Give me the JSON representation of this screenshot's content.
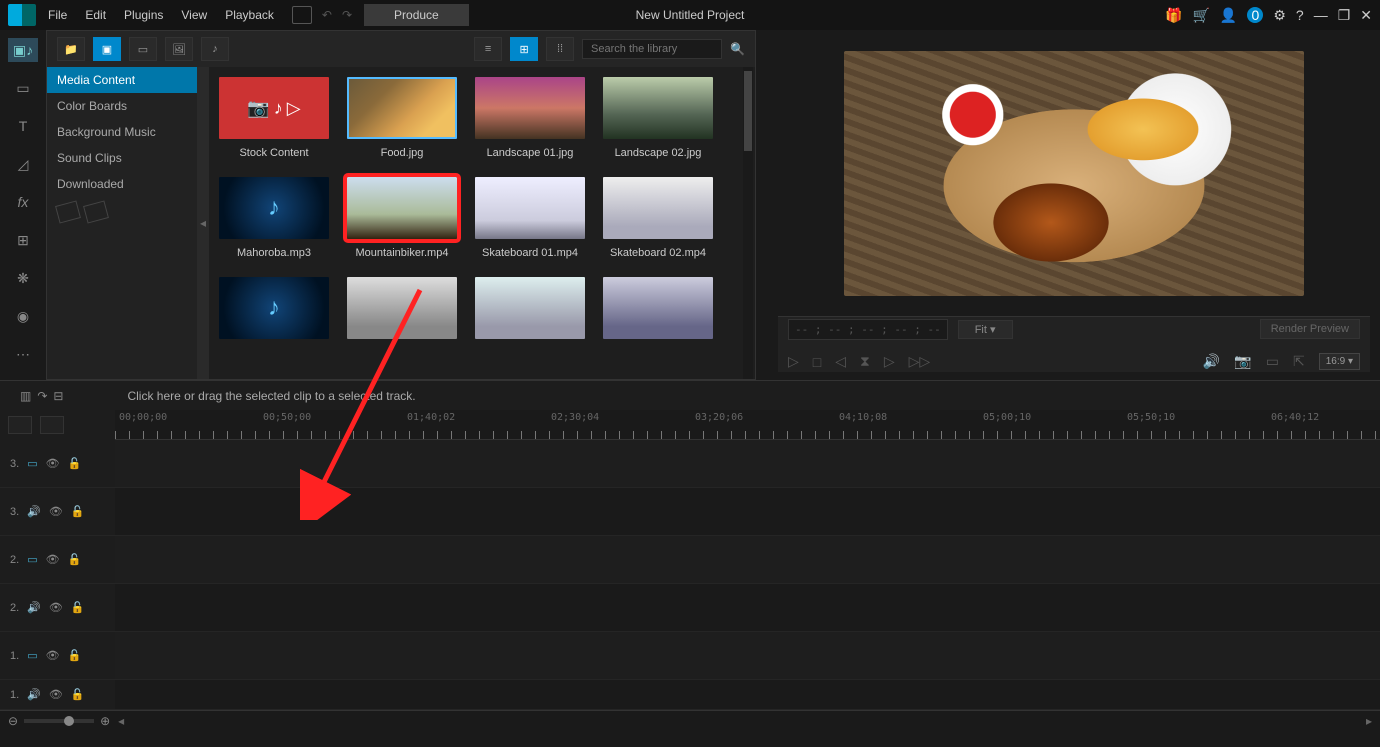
{
  "menu": {
    "file": "File",
    "edit": "Edit",
    "plugins": "Plugins",
    "view": "View",
    "playback": "Playback"
  },
  "produce": "Produce",
  "title": "New Untitled Project",
  "search_ph": "Search the library",
  "categories": {
    "media": "Media Content",
    "color": "Color Boards",
    "bgm": "Background Music",
    "snd": "Sound Clips",
    "dl": "Downloaded"
  },
  "items": {
    "stock": "Stock Content",
    "food": "Food.jpg",
    "land1": "Landscape 01.jpg",
    "land2": "Landscape 02.jpg",
    "maho": "Mahoroba.mp3",
    "mtn": "Mountainbiker.mp4",
    "sk1": "Skateboard 01.mp4",
    "sk2": "Skateboard 02.mp4"
  },
  "timecode": "-- ; -- ; -- ; --  ; --",
  "fit": "Fit",
  "render": "Render Preview",
  "aspect": "16:9",
  "timeline_hint": "Click here or drag the selected clip to a selected track.",
  "ruler": {
    "t0": "00;00;00",
    "t1": "00;50;00",
    "t2": "01;40;02",
    "t3": "02;30;04",
    "t4": "03;20;06",
    "t5": "04;10;08",
    "t6": "05;00;10",
    "t7": "05;50;10",
    "t8": "06;40;12"
  },
  "tracks": {
    "v3": "3.",
    "a3": "3.",
    "v2": "2.",
    "a2": "2.",
    "v1": "1.",
    "a1": "1."
  }
}
